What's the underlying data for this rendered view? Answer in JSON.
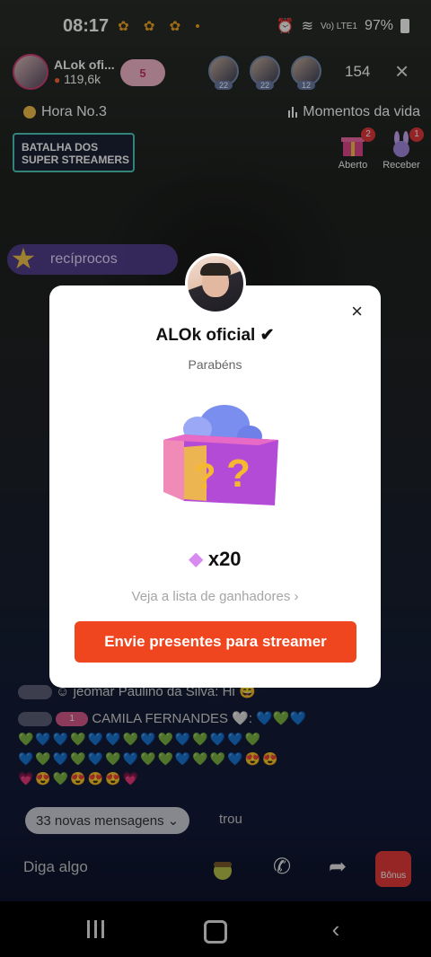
{
  "status_bar": {
    "time": "08:17",
    "notif_icons": "✿ ✿ ✿ •",
    "signal_text": "Vo) LTE1",
    "battery": "97%"
  },
  "live_header": {
    "host_name": "ALok ofi...",
    "host_fans": "119,6k",
    "follow_badge": "5",
    "viewers": [
      {
        "level": "22"
      },
      {
        "level": "22"
      },
      {
        "level": "12"
      }
    ],
    "viewer_count": "154",
    "close_icon": "×"
  },
  "info_bar": {
    "hour_rank": "Hora No.3",
    "moments": "Momentos da vida"
  },
  "battle_banner": {
    "line1": "BATALHA DOS",
    "line2": "SUPER STREAMERS"
  },
  "side_gifts": [
    {
      "label": "Aberto",
      "badge": "2"
    },
    {
      "label": "Receber",
      "badge": "1"
    }
  ],
  "reciprocos": "recíprocos",
  "chat": {
    "line1_name": "jeomar Paulino da Silva: Hi",
    "line2_level": "1",
    "line2_name": "CAMILA FERNANDES 🤍:",
    "line2_emojis": "💙💚💙",
    "line3_emojis": "💚💙💙💚💙💙💚💙💚💙💚💙💙💚",
    "line4_emojis": "💙💚💙💚💙💚💙💚💚💙💚💚💙😍😍",
    "line5_emojis": "💗😍💚😍😍😍💗",
    "new_messages": "33 novas mensagens",
    "trailing": "trou"
  },
  "bottom_bar": {
    "say_placeholder": "Diga algo",
    "bonus_label": "Bônus"
  },
  "modal": {
    "name": "ALOk oficial ✔",
    "subtitle": "Parabéns",
    "reward_amount": "x20",
    "winners_link": "Veja a lista de ganhadores ›",
    "send_button": "Envie presentes para streamer",
    "close_icon": "×"
  },
  "colors": {
    "accent_orange": "#f0461f",
    "battle_border": "#4fc9b8",
    "reciprocos_bg": "#6e50c8"
  }
}
